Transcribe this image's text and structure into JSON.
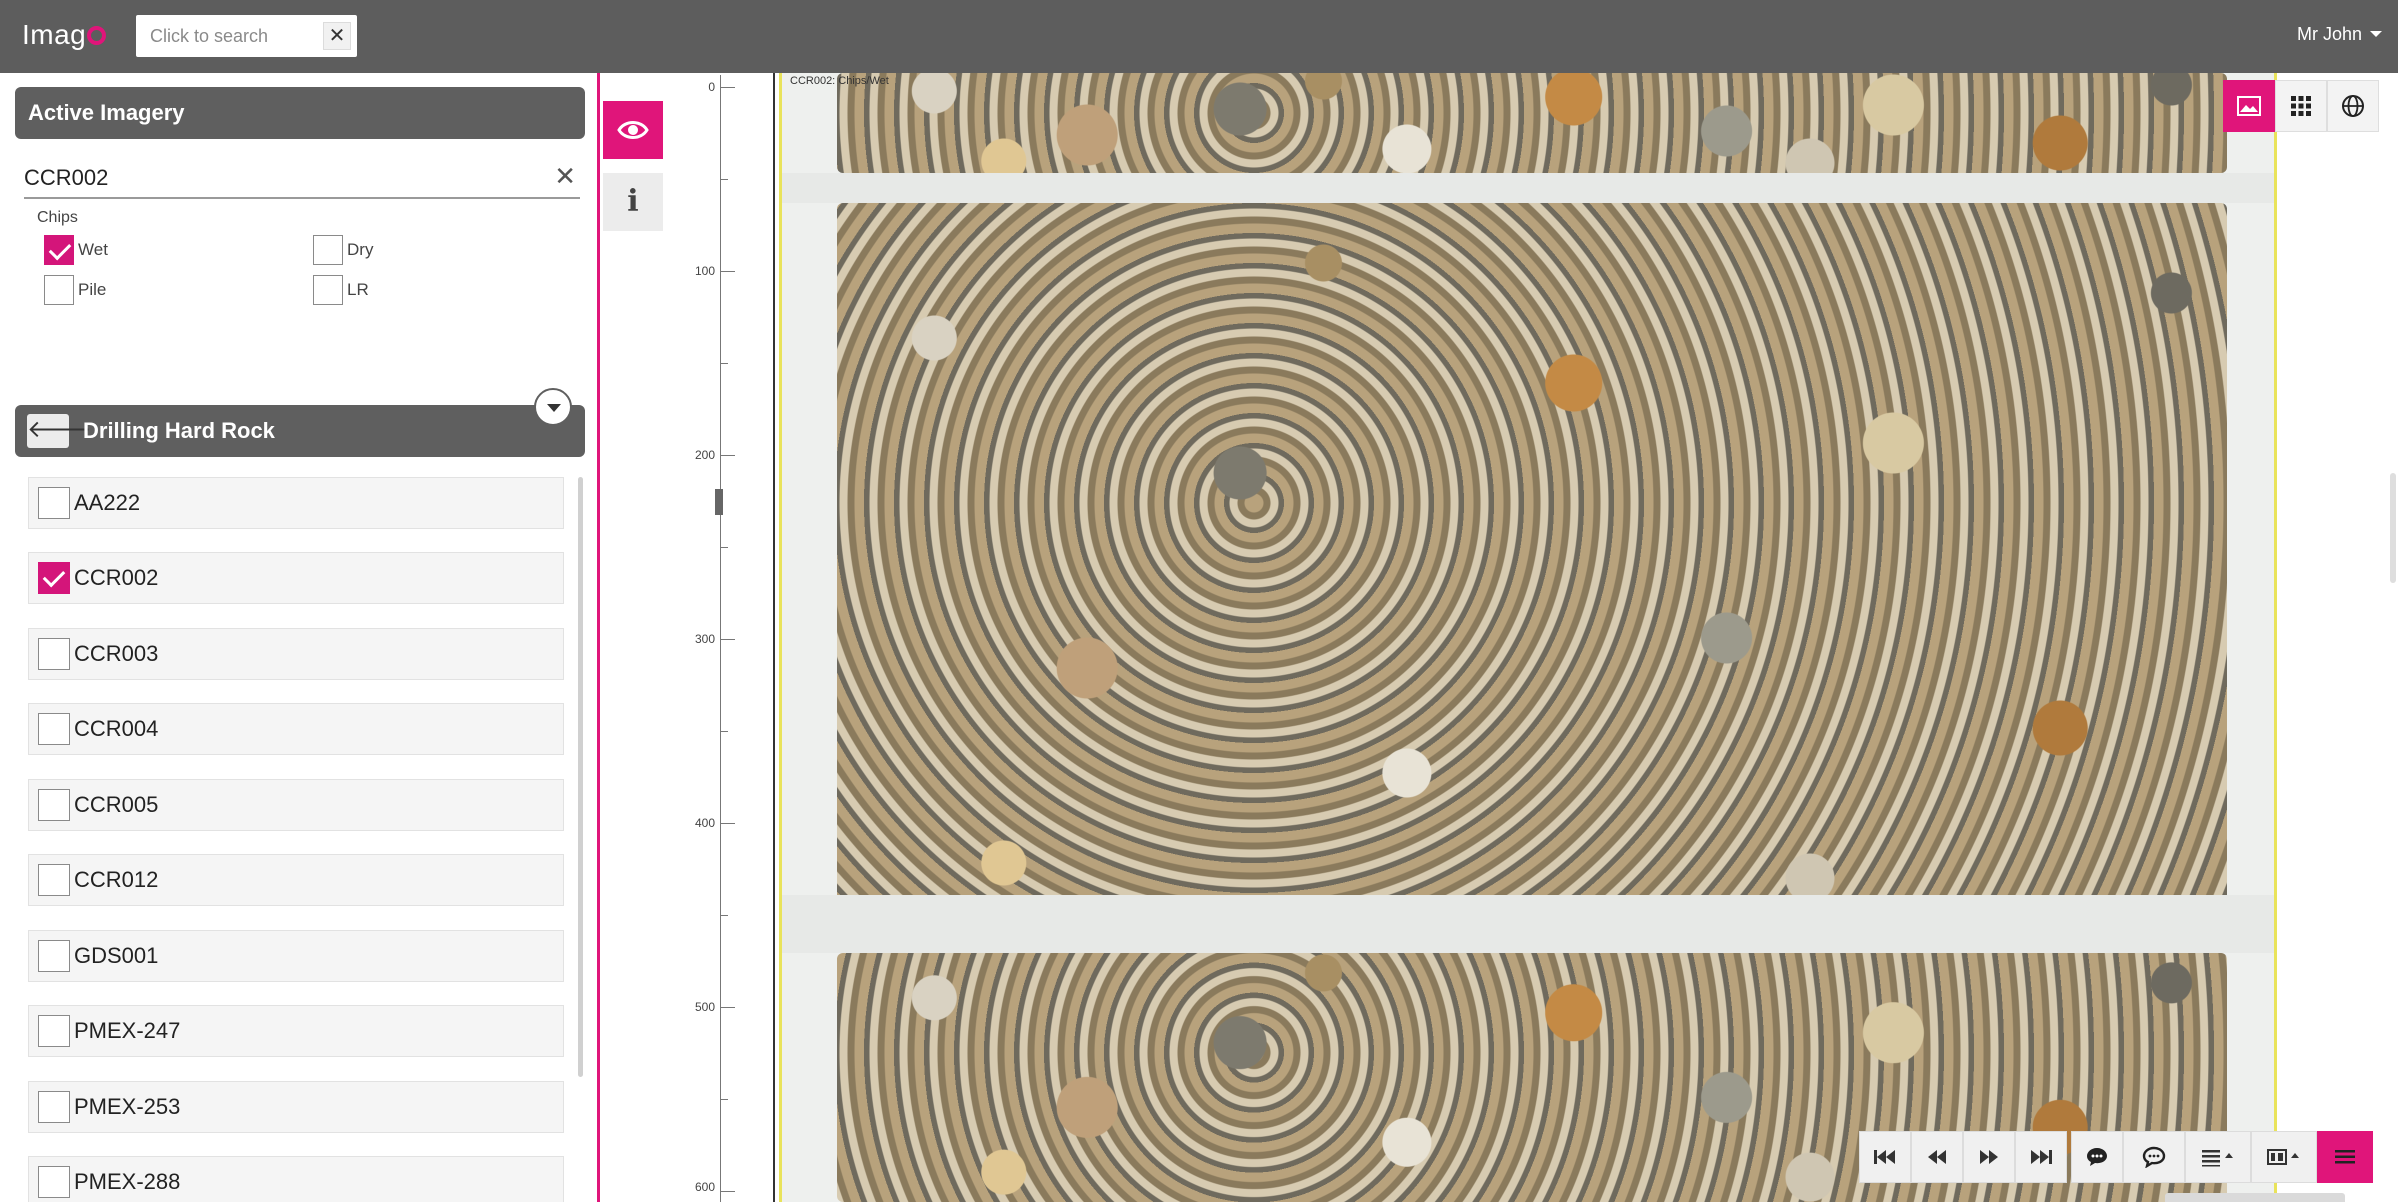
{
  "app": {
    "logo_text": "Imag",
    "brand_color": "#e0157a"
  },
  "topbar": {
    "search_placeholder": "Click to search",
    "search_clear_label": "✕",
    "user_name": "Mr John"
  },
  "panel": {
    "title": "Active Imagery",
    "hole_value": "CCR002",
    "hole_clear_label": "✕",
    "chips_label": "Chips",
    "options": [
      {
        "label": "Wet",
        "checked": true
      },
      {
        "label": "Dry",
        "checked": false
      },
      {
        "label": "Pile",
        "checked": false
      },
      {
        "label": "LR",
        "checked": false
      }
    ]
  },
  "project": {
    "back_label": "🡐",
    "title": "Drilling Hard Rock",
    "holes": [
      {
        "label": "AA222",
        "checked": false
      },
      {
        "label": "CCR002",
        "checked": true
      },
      {
        "label": "CCR003",
        "checked": false
      },
      {
        "label": "CCR004",
        "checked": false
      },
      {
        "label": "CCR005",
        "checked": false
      },
      {
        "label": "CCR012",
        "checked": false
      },
      {
        "label": "GDS001",
        "checked": false
      },
      {
        "label": "PMEX-247",
        "checked": false
      },
      {
        "label": "PMEX-253",
        "checked": false
      },
      {
        "label": "PMEX-288",
        "checked": false
      }
    ]
  },
  "side_tabs": {
    "info_label": "i"
  },
  "ruler": {
    "labels": [
      "0",
      "100",
      "200",
      "300",
      "400",
      "500",
      "600"
    ]
  },
  "image": {
    "caption": "CCR002: Chips/Wet"
  },
  "icons": {
    "view_toolbar": [
      "image-view-icon",
      "grid-view-icon",
      "globe-icon"
    ],
    "bottom_toolbar": [
      "first-icon",
      "previous-icon",
      "next-icon",
      "last-icon",
      "comment-icon",
      "comments-icon",
      "list-menu-icon",
      "film-menu-icon",
      "menu-icon"
    ]
  }
}
